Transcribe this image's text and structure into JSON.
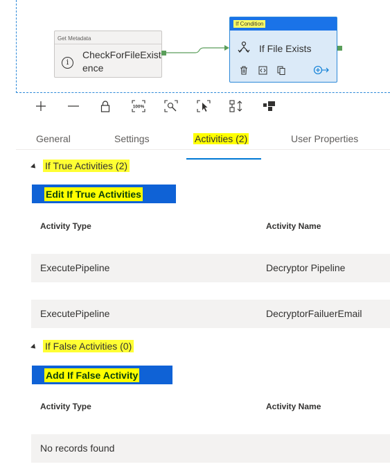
{
  "canvas": {
    "get_metadata": {
      "type_label": "Get Metadata",
      "name": "CheckForFileExistence",
      "icon": "info-icon"
    },
    "if_condition": {
      "type_label": "If Condition",
      "name": "If File Exists",
      "icons": [
        "if-condition-icon",
        "delete-icon",
        "code-icon",
        "copy-icon",
        "add-output-icon"
      ]
    }
  },
  "toolbar": {
    "icons": [
      "zoom-in-icon",
      "zoom-out-icon",
      "lock-icon",
      "zoom-100-icon",
      "zoom-fit-icon",
      "select-icon",
      "auto-align-icon",
      "layout-icon"
    ],
    "zoom_100_label": "100%"
  },
  "tabs": [
    {
      "label": "General"
    },
    {
      "label": "Settings"
    },
    {
      "label": "Activities (2)"
    },
    {
      "label": "User Properties"
    }
  ],
  "true_section": {
    "header": "If True Activities (2)",
    "button": "Edit If True Activities",
    "columns": [
      "Activity Type",
      "Activity Name"
    ],
    "rows": [
      {
        "type": "ExecutePipeline",
        "name": "Decryptor Pipeline"
      },
      {
        "type": "ExecutePipeline",
        "name": "DecryptorFailuerEmail"
      }
    ]
  },
  "false_section": {
    "header": "If False Activities (0)",
    "button": "Add If False Activity",
    "columns": [
      "Activity Type",
      "Activity Name"
    ],
    "empty_text": "No records found"
  },
  "colors": {
    "accent": "#0078d4",
    "button_bg": "#0f62d6",
    "highlight": "#ffff00",
    "port": "#5a9e5a"
  }
}
